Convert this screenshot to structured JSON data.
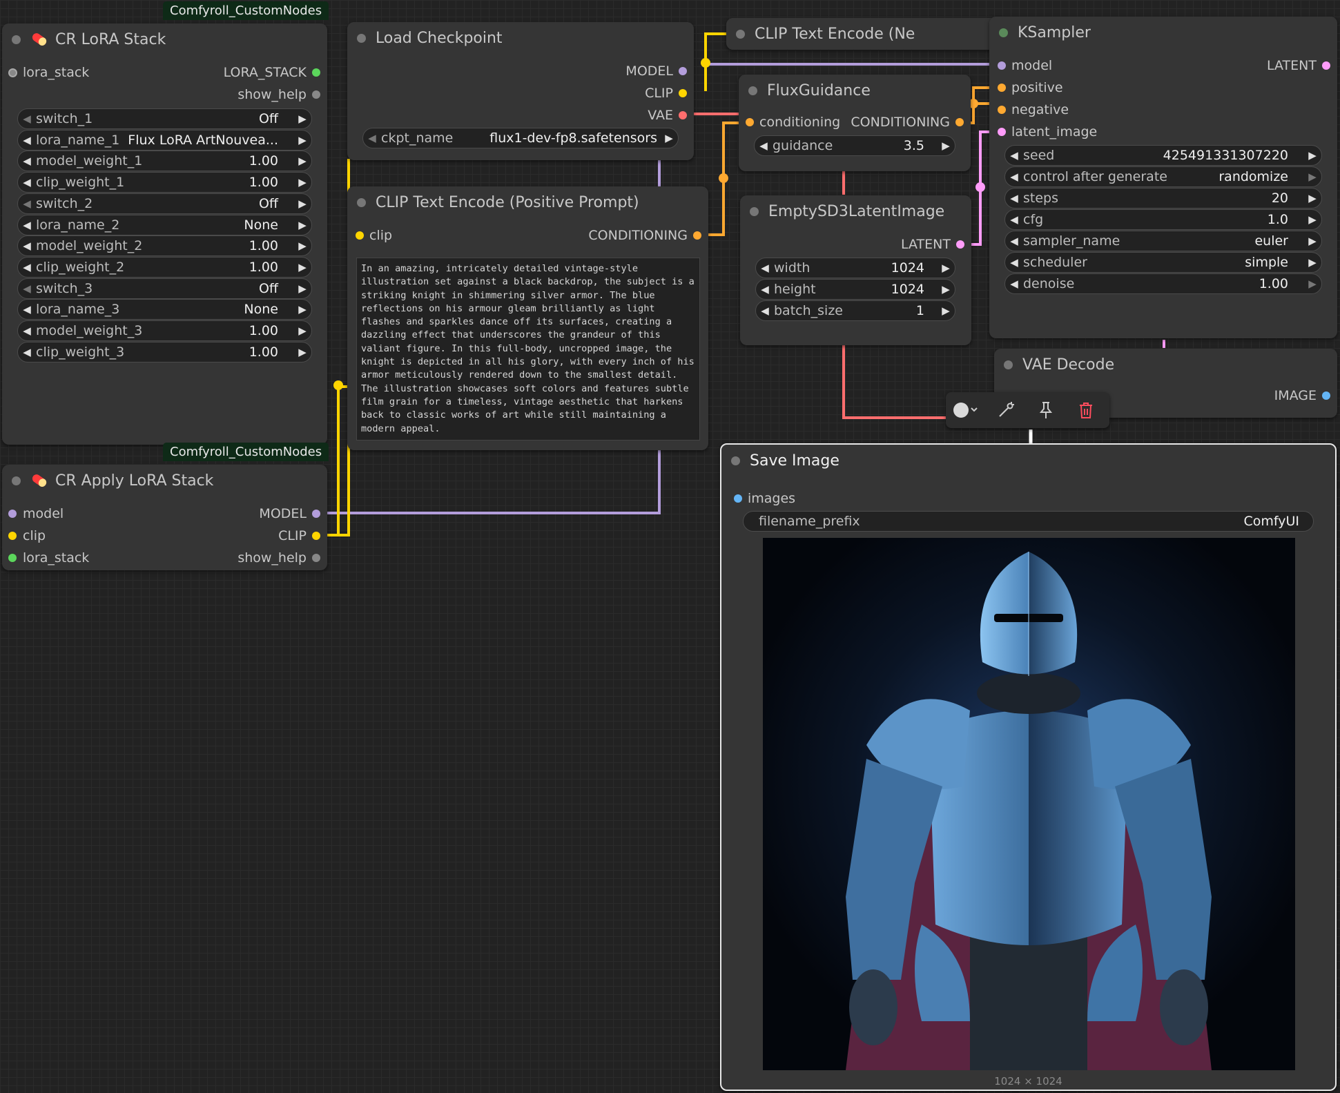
{
  "badges": {
    "top": "Comfyroll_CustomNodes",
    "bottom": "Comfyroll_CustomNodes"
  },
  "lora_stack_node": {
    "title": "CR LoRA Stack",
    "input": "lora_stack",
    "outputs": [
      "LORA_STACK",
      "show_help"
    ],
    "widgets": [
      {
        "label": "switch_1",
        "value": "Off"
      },
      {
        "label": "lora_name_1",
        "value": "Flux LoRA ArtNouvea..."
      },
      {
        "label": "model_weight_1",
        "value": "1.00"
      },
      {
        "label": "clip_weight_1",
        "value": "1.00"
      },
      {
        "label": "switch_2",
        "value": "Off"
      },
      {
        "label": "lora_name_2",
        "value": "None"
      },
      {
        "label": "model_weight_2",
        "value": "1.00"
      },
      {
        "label": "clip_weight_2",
        "value": "1.00"
      },
      {
        "label": "switch_3",
        "value": "Off"
      },
      {
        "label": "lora_name_3",
        "value": "None"
      },
      {
        "label": "model_weight_3",
        "value": "1.00"
      },
      {
        "label": "clip_weight_3",
        "value": "1.00"
      }
    ]
  },
  "apply_lora_node": {
    "title": "CR Apply LoRA Stack",
    "inputs": [
      "model",
      "clip",
      "lora_stack"
    ],
    "outputs": [
      "MODEL",
      "CLIP",
      "show_help"
    ]
  },
  "load_checkpoint_node": {
    "title": "Load Checkpoint",
    "outputs": [
      "MODEL",
      "CLIP",
      "VAE"
    ],
    "widget": {
      "label": "ckpt_name",
      "value": "flux1-dev-fp8.safetensors"
    }
  },
  "clip_positive_node": {
    "title": "CLIP Text Encode (Positive Prompt)",
    "input": "clip",
    "output": "CONDITIONING",
    "text": "In an amazing, intricately detailed vintage-style illustration set against a black backdrop, the subject is a striking knight in shimmering silver armor. The blue reflections on his armour gleam brilliantly as light flashes and sparkles dance off its surfaces, creating a dazzling effect that underscores the grandeur of this valiant figure. In this full-body, uncropped image, the knight is depicted in all his glory, with every inch of his armor meticulously rendered down to the smallest detail. The illustration showcases soft colors and features subtle film grain for a timeless, vintage aesthetic that harkens back to classic works of art while still maintaining a modern appeal."
  },
  "clip_negative_node": {
    "title": "CLIP Text Encode (Ne"
  },
  "flux_guidance_node": {
    "title": "FluxGuidance",
    "input": "conditioning",
    "output": "CONDITIONING",
    "widget": {
      "label": "guidance",
      "value": "3.5"
    }
  },
  "empty_latent_node": {
    "title": "EmptySD3LatentImage",
    "output": "LATENT",
    "widgets": [
      {
        "label": "width",
        "value": "1024"
      },
      {
        "label": "height",
        "value": "1024"
      },
      {
        "label": "batch_size",
        "value": "1"
      }
    ]
  },
  "ksampler_node": {
    "title": "KSampler",
    "inputs": [
      "model",
      "positive",
      "negative",
      "latent_image"
    ],
    "output": "LATENT",
    "widgets": [
      {
        "label": "seed",
        "value": "425491331307220"
      },
      {
        "label": "control after generate",
        "value": "randomize"
      },
      {
        "label": "steps",
        "value": "20"
      },
      {
        "label": "cfg",
        "value": "1.0"
      },
      {
        "label": "sampler_name",
        "value": "euler"
      },
      {
        "label": "scheduler",
        "value": "simple"
      },
      {
        "label": "denoise",
        "value": "1.00"
      }
    ]
  },
  "vae_decode_node": {
    "title": "VAE Decode",
    "output": "IMAGE"
  },
  "save_image_node": {
    "title": "Save Image",
    "input": "images",
    "widget": {
      "label": "filename_prefix",
      "value": "ComfyUI"
    },
    "image_size": "1024 × 1024"
  },
  "toolbar": {
    "icons": [
      "color-circle-icon",
      "bypass-wand-icon",
      "pin-icon",
      "trash-icon"
    ]
  },
  "colors": {
    "model": "#b39ddb",
    "clip": "#ffd500",
    "vae": "#ff6e6e",
    "conditioning": "#ffa931",
    "latent": "#ff9cf9",
    "image": "#64b5f6",
    "lora_stack": "#5cd65c"
  }
}
